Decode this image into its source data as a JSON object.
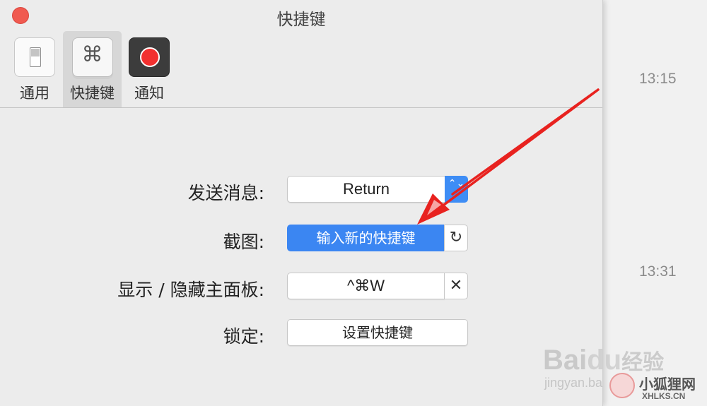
{
  "background": {
    "times": [
      "13:15",
      "13:31"
    ]
  },
  "window": {
    "title": "快捷键"
  },
  "tabs": [
    {
      "label": "通用",
      "icon": "switch-icon"
    },
    {
      "label": "快捷键",
      "icon": "command-key-icon",
      "glyph": "⌘",
      "active": true
    },
    {
      "label": "通知",
      "icon": "record-icon"
    }
  ],
  "shortcuts": [
    {
      "label": "发送消息:",
      "value": "Return",
      "control": "popup",
      "arrows": "⌃⌄"
    },
    {
      "label": "截图:",
      "value": "输入新的快捷键",
      "control": "recording",
      "action_glyph": "↻"
    },
    {
      "label": "显示 / 隐藏主面板:",
      "value": "^⌘W",
      "control": "shortcut",
      "action_glyph": "✕"
    },
    {
      "label": "锁定:",
      "value": "设置快捷键",
      "control": "button"
    }
  ],
  "watermark": {
    "brand": "Bai",
    "brand2": "du",
    "brand3": "经验",
    "site": "jingyan.ba",
    "site2": "小狐狸网",
    "site3": "XHLKS.CN"
  },
  "colors": {
    "accent": "#3b86f2",
    "close": "#f05a50",
    "arrow": "#e8221f"
  }
}
